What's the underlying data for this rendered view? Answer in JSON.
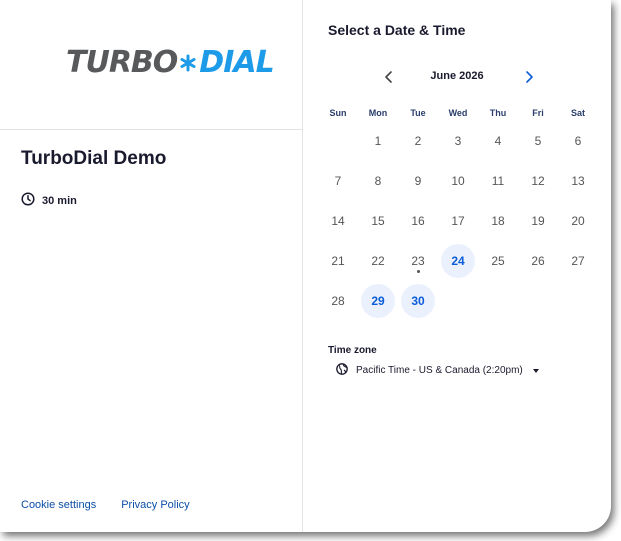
{
  "logo": {
    "part1": "TURBO",
    "part2": "DIAL",
    "star_icon": "snowflake-icon",
    "colors": {
      "gray": "#58595b",
      "blue": "#1e9be8"
    }
  },
  "event": {
    "title": "TurboDial Demo",
    "duration": "30 min",
    "duration_icon": "clock-icon"
  },
  "footer": {
    "cookie": "Cookie settings",
    "privacy": "Privacy Policy"
  },
  "calendar": {
    "heading": "Select a Date & Time",
    "month": "June 2026",
    "prev_icon": "chevron-left-icon",
    "next_icon": "chevron-right-icon",
    "weekdays": [
      "Sun",
      "Mon",
      "Tue",
      "Wed",
      "Thu",
      "Fri",
      "Sat"
    ],
    "days": [
      {
        "d": ""
      },
      {
        "d": "1"
      },
      {
        "d": "2"
      },
      {
        "d": "3"
      },
      {
        "d": "4"
      },
      {
        "d": "5"
      },
      {
        "d": "6"
      },
      {
        "d": "7"
      },
      {
        "d": "8"
      },
      {
        "d": "9"
      },
      {
        "d": "10"
      },
      {
        "d": "11"
      },
      {
        "d": "12"
      },
      {
        "d": "13"
      },
      {
        "d": "14"
      },
      {
        "d": "15"
      },
      {
        "d": "16"
      },
      {
        "d": "17"
      },
      {
        "d": "18"
      },
      {
        "d": "19"
      },
      {
        "d": "20"
      },
      {
        "d": "21"
      },
      {
        "d": "22"
      },
      {
        "d": "23",
        "today": true
      },
      {
        "d": "24",
        "available": true
      },
      {
        "d": "25"
      },
      {
        "d": "26"
      },
      {
        "d": "27"
      },
      {
        "d": "28"
      },
      {
        "d": "29",
        "available": true
      },
      {
        "d": "30",
        "available": true
      }
    ],
    "accent": "#0b5cd6"
  },
  "timezone": {
    "label": "Time zone",
    "value": "Pacific Time - US & Canada (2:20pm)",
    "icon": "globe-icon"
  }
}
